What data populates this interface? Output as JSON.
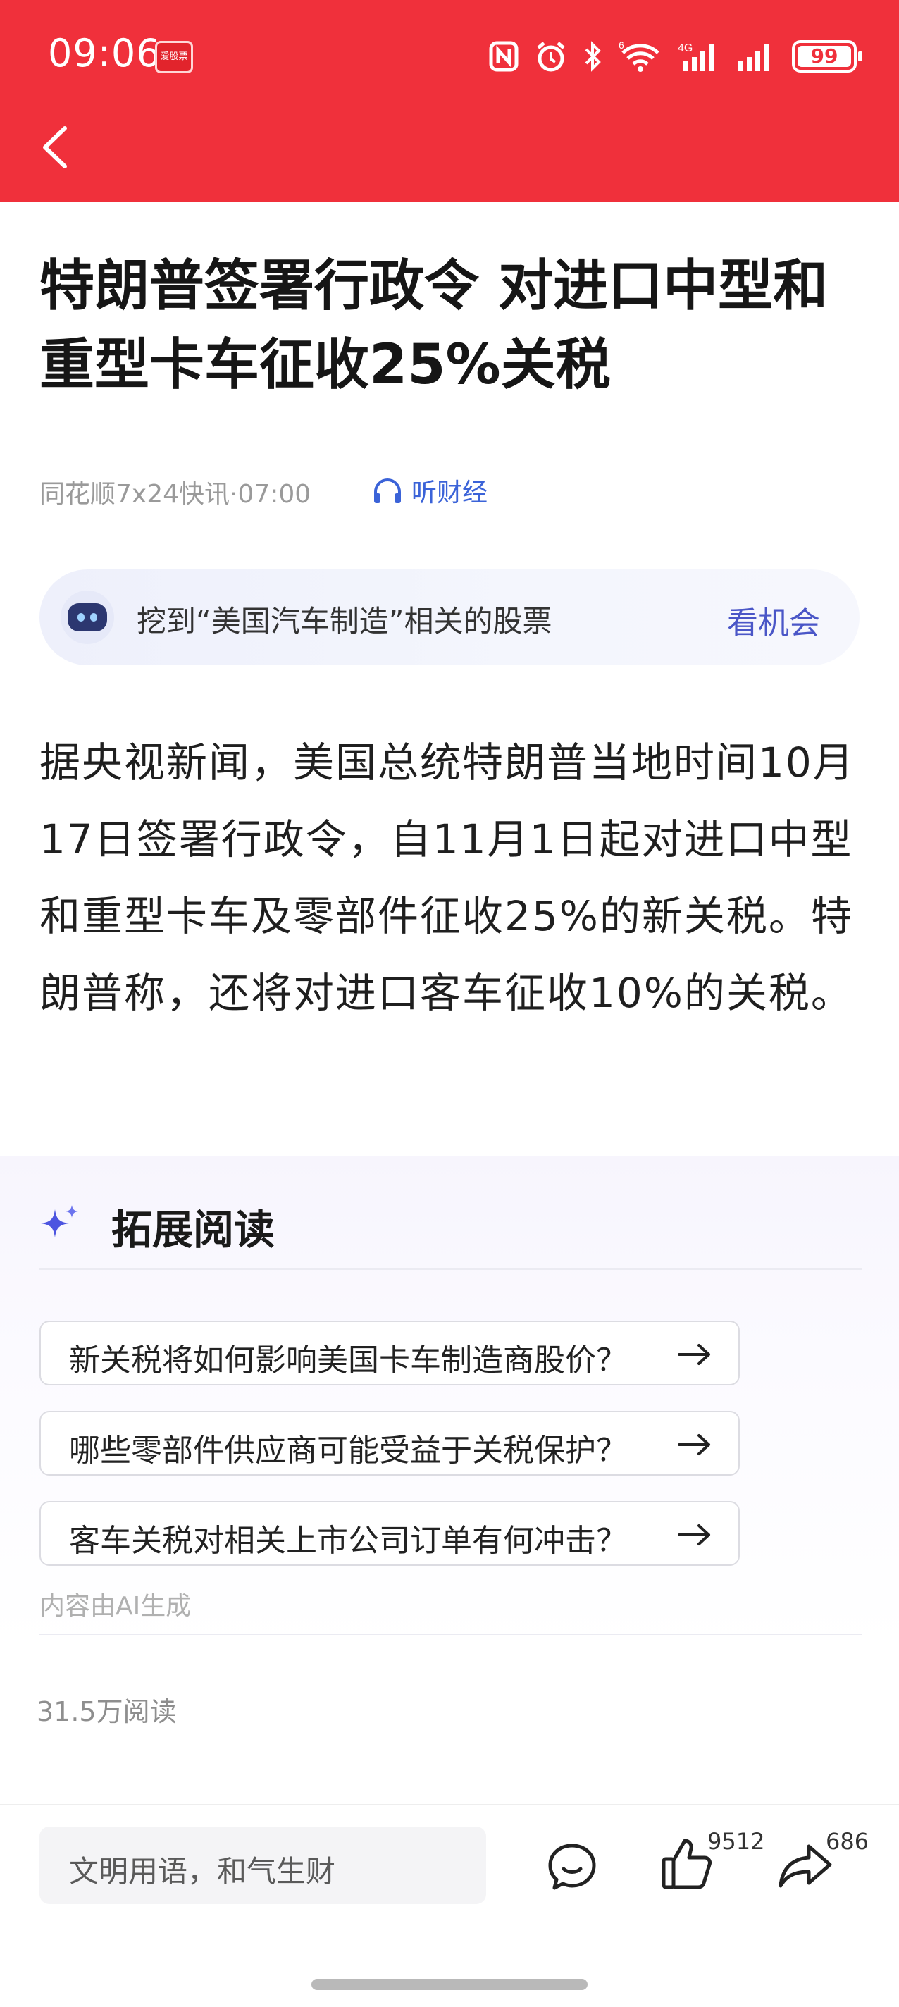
{
  "status_bar": {
    "time": "09:06",
    "app_badge": "爱股票",
    "battery": "99"
  },
  "article": {
    "title": "特朗普签署行政令 对进口中型和重型卡车征收25%关税",
    "source": "同花顺7x24快讯·07:00",
    "listen_label": "听财经",
    "body": "据央视新闻，美国总统特朗普当地时间10月17日签署行政令，自11月1日起对进口中型和重型卡车及零部件征收25%的新关税。特朗普称，还将对进口客车征收10%的关税。"
  },
  "ai_bar": {
    "text": "挖到“美国汽车制造”相关的股票",
    "link": "看机会"
  },
  "extended_reading": {
    "title": "拓展阅读",
    "questions": [
      "新关税将如何影响美国卡车制造商股价？",
      "哪些零部件供应商可能受益于关税保护？",
      "客车关税对相关上市公司订单有何冲击？"
    ],
    "note": "内容由AI生成"
  },
  "read_count": "31.5万阅读",
  "bottom_bar": {
    "comment_placeholder": "文明用语，和气生财",
    "like_count": "9512",
    "share_count": "686"
  },
  "colors": {
    "header": "#f0303b",
    "accent_blue": "#3b63d8",
    "link_purple": "#4a56c7"
  },
  "icons": [
    "back-arrow-icon",
    "headphones-icon",
    "robot-icon",
    "sparkle-icon",
    "arrow-right-icon",
    "comment-icon",
    "thumbs-up-icon",
    "share-icon"
  ]
}
